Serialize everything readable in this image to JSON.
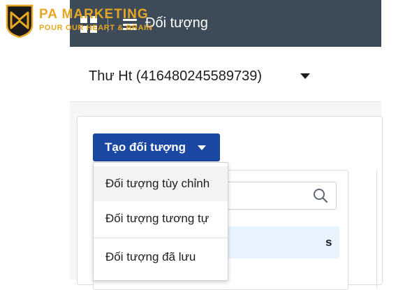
{
  "logo": {
    "brand": "PA MARKETING",
    "slogan": "POUR OUR HEART & BRAIN",
    "accent_color": "#e8a722"
  },
  "topbar": {
    "title": "Đối tượng",
    "background_color": "#3d4a58"
  },
  "account_selector": {
    "label": "Thư Ht (416480245589739)"
  },
  "toolbar": {
    "create_button_label": "Tạo đối tượng",
    "button_color": "#1a47a1"
  },
  "dropdown": {
    "items": [
      {
        "label": "Đối tượng tùy chỉnh"
      },
      {
        "label": "Đối tượng tương tự"
      },
      {
        "label": "Đối tượng đã lưu"
      }
    ]
  },
  "background_list": {
    "partial_text": "s"
  },
  "icons": [
    "pa-marketing-shield-icon",
    "apps-grid-icon",
    "hamburger-menu-icon",
    "chevron-down-icon",
    "search-icon"
  ]
}
